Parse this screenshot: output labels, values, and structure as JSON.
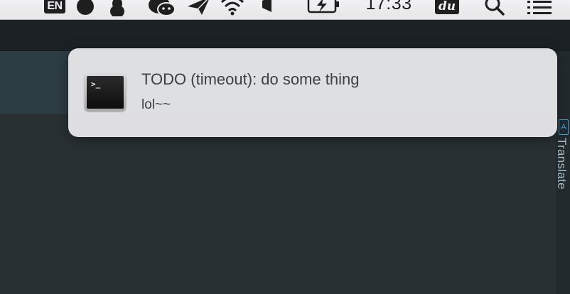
{
  "menubar": {
    "input_source": "EN",
    "clock": "17:33",
    "du_app": "du",
    "icons": [
      "circle-app-icon",
      "penguin-icon",
      "wechat-icon",
      "send-icon",
      "wifi-icon",
      "notification-bell-icon",
      "battery-charging-icon",
      "search-icon",
      "list-icon"
    ]
  },
  "notification": {
    "app_icon": "terminal-icon",
    "title": "TODO (timeout): do some thing",
    "body": "lol~~"
  },
  "side_panel": {
    "badge": "A",
    "label": "Translate"
  },
  "colors": {
    "menubar_bg": "#ececee",
    "app_toolbar": "#1b2124",
    "app_header_band": "#2d3d44",
    "app_body": "#293033",
    "notification_bg": "#e4e4e6",
    "translate_accent": "#3f9fd4"
  }
}
